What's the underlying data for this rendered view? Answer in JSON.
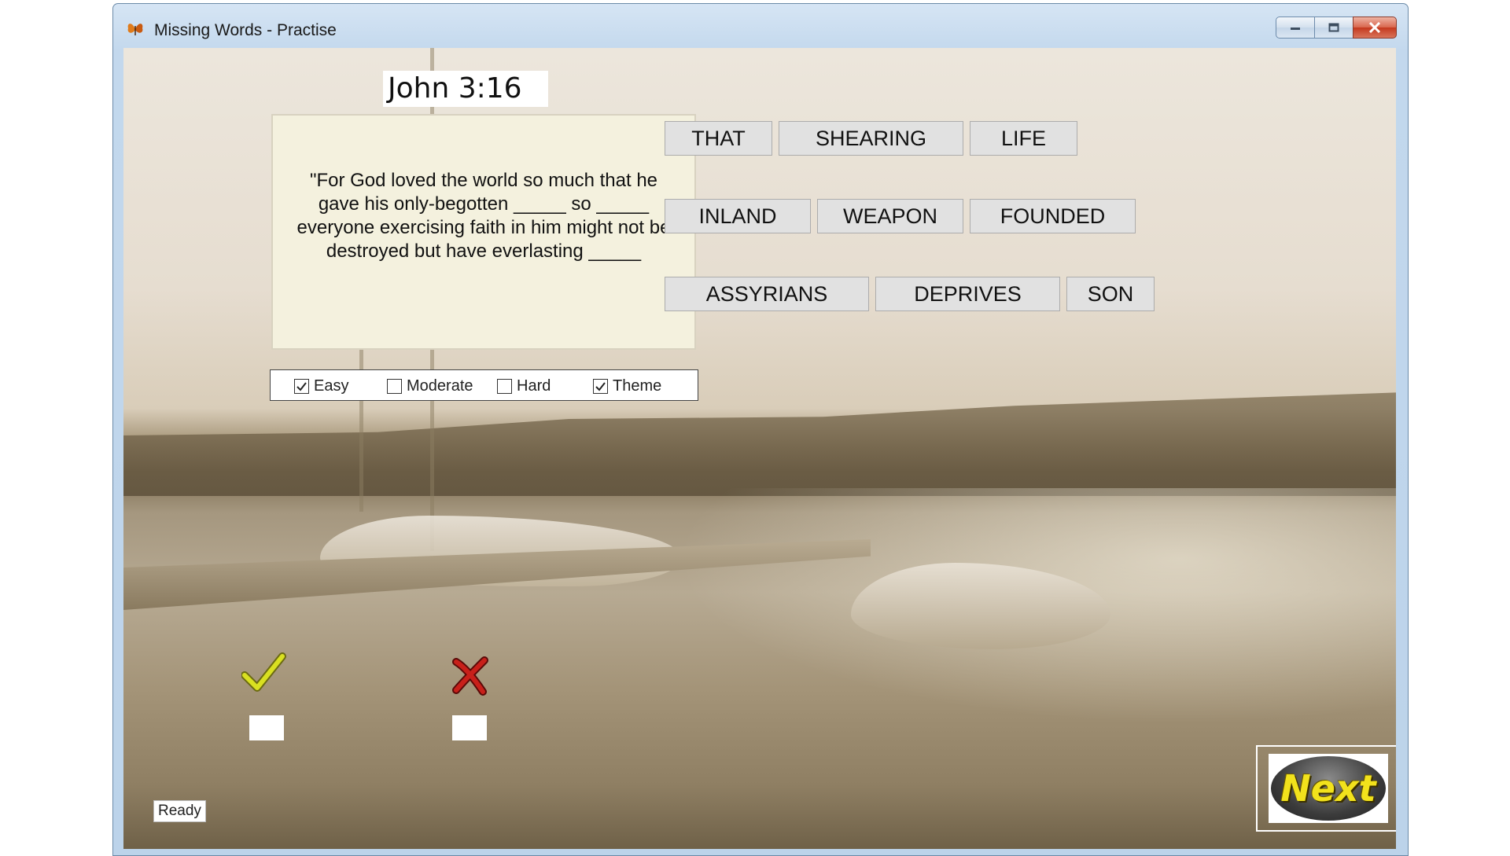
{
  "window": {
    "title": "Missing Words - Practise",
    "controls": [
      "minimize-icon",
      "maximize-icon",
      "close-icon"
    ],
    "close_color": "#c4381e"
  },
  "reference": "John 3:16",
  "verse": "\"For God loved the world so much that he gave his only-begotten _____ so _____ everyone exercising faith in him might not be destroyed but have everlasting _____",
  "difficulty": [
    {
      "label": "Easy",
      "checked": true
    },
    {
      "label": "Moderate",
      "checked": false
    },
    {
      "label": "Hard",
      "checked": false
    },
    {
      "label": "Theme",
      "checked": true
    }
  ],
  "words": [
    [
      "THAT",
      "SHEARING",
      "LIFE"
    ],
    [
      "INLAND",
      "WEAPON",
      "FOUNDED"
    ],
    [
      "ASSYRIANS",
      "DEPRIVES",
      "SON"
    ]
  ],
  "feedback": {
    "correct_icon": "check-icon",
    "correct_count": "",
    "wrong_icon": "cross-icon",
    "wrong_count": ""
  },
  "status": "Ready",
  "next_label": "Next",
  "colors": {
    "verse_bg": "#f4f1de",
    "word_button_bg": "#e1e1e1",
    "next_text": "#f2e21c",
    "check": "#d9e021",
    "cross": "#c8201a"
  }
}
